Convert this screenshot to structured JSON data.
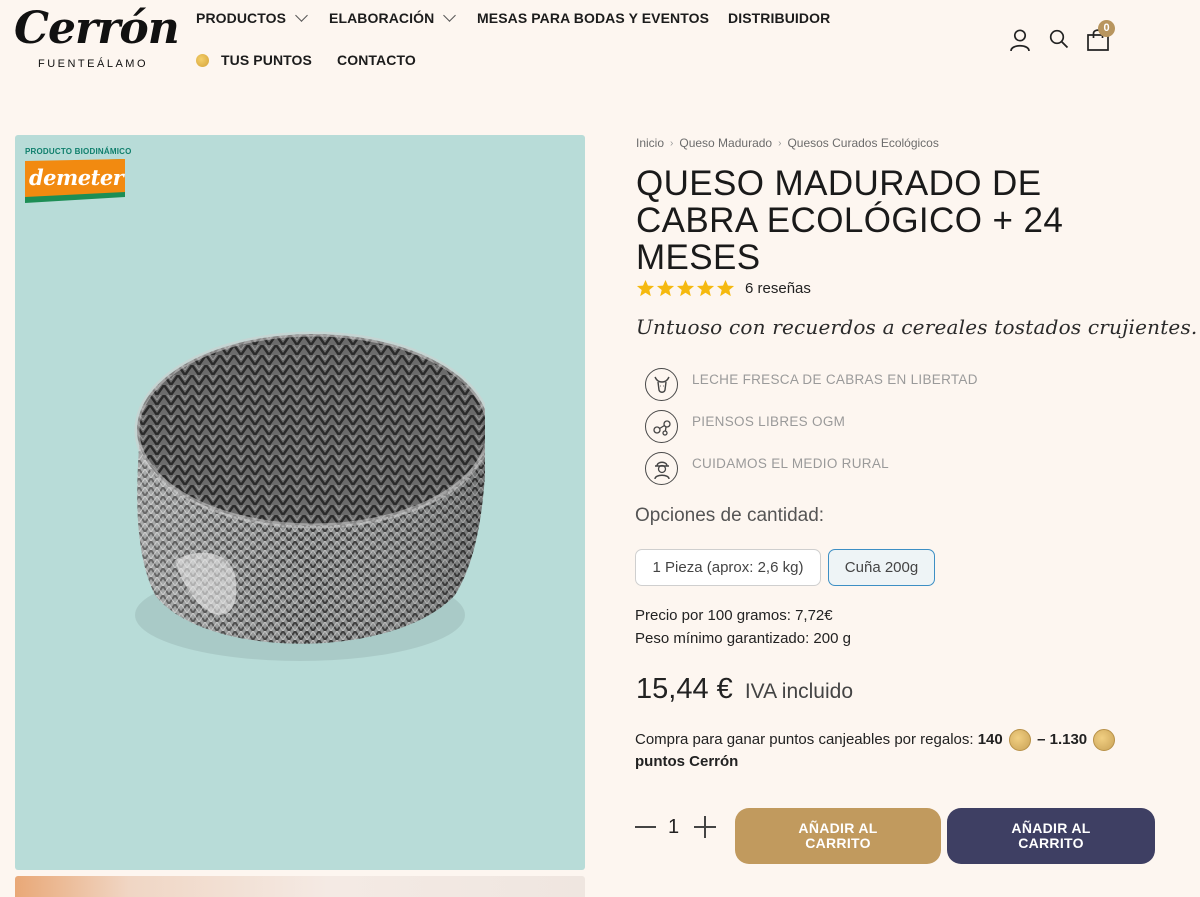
{
  "brand": {
    "name": "Cerrón",
    "sub": "FUENTEÁLAMO"
  },
  "nav": {
    "productos": "PRODUCTOS",
    "elaboracion": "ELABORACIÓN",
    "mesas": "MESAS PARA BODAS Y EVENTOS",
    "distribuidor": "DISTRIBUIDOR",
    "puntos": "TUS PUNTOS",
    "contacto": "CONTACTO"
  },
  "header": {
    "cart_count": "0",
    "icons": [
      "user-icon",
      "search-icon",
      "cart-icon"
    ]
  },
  "image": {
    "badge_text": "PRODUCTO BIODINÁMICO",
    "logo_text": "demeter"
  },
  "breadcrumb": [
    "Inicio",
    "Queso Madurado",
    "Quesos Curados Ecológicos"
  ],
  "product": {
    "title": "QUESO MADURADO DE CABRA ECOLÓGICO + 24 MESES",
    "rating": 5,
    "reviews": "6 reseñas",
    "tagline": "Untuoso con recuerdos a cereales tostados crujientes.",
    "features": [
      {
        "icon": "goat-icon",
        "text": "LECHE FRESCA DE CABRAS EN LIBERTAD"
      },
      {
        "icon": "molecule-icon",
        "text": "PIENSOS LIBRES OGM"
      },
      {
        "icon": "farmer-icon",
        "text": "CUIDAMOS EL MEDIO RURAL"
      }
    ],
    "options_label": "Opciones de cantidad:",
    "options": [
      "1 Pieza (aprox: 2,6 kg)",
      "Cuña 200g"
    ],
    "selected_option": "Cuña 200g",
    "price_per_100g": "Precio por 100 gramos: 7,72€",
    "min_weight": "Peso mínimo garantizado: 200 g",
    "price": "15,44 €",
    "price_tax": "IVA incluido",
    "points_text": "Compra para ganar puntos canjeables por regalos:",
    "points_min": "140",
    "points_sep": "–",
    "points_max": "1.130",
    "points_unit": "puntos Cerrón",
    "quantity": "1",
    "add_to_cart_1": "AÑADIR AL CARRITO",
    "add_to_cart_2": "AÑADIR AL CARRITO"
  },
  "colors": {
    "background": "#fdf6f0",
    "image_bg": "#b8dcd8",
    "gold": "#c19a5e",
    "navy": "#3e3f63",
    "star": "#f5b90f",
    "selected_border": "#3d8fc4"
  }
}
